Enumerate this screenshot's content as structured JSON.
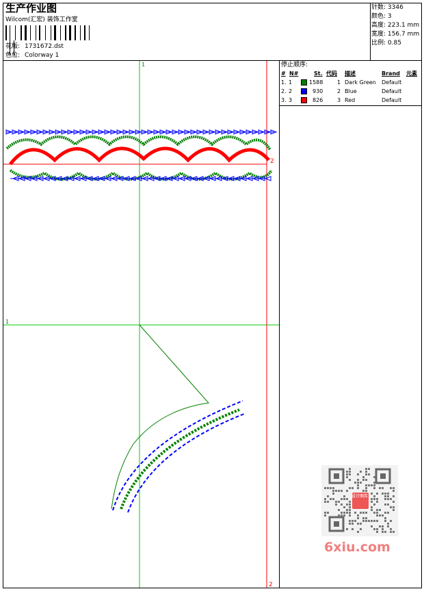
{
  "header": {
    "title": "生产作业图",
    "company": "Wilcom(汇宏) 装饰工作室",
    "design_label": "花版:",
    "design_value": "1731672.dst",
    "colorway_label": "色位:",
    "colorway_value": "Colorway 1"
  },
  "stats": [
    {
      "label": "针数:",
      "value": "3346"
    },
    {
      "label": "颜色:",
      "value": "3"
    },
    {
      "label": "高度:",
      "value": "223.1 mm"
    },
    {
      "label": "宽度:",
      "value": "156.7 mm"
    },
    {
      "label": "比例:",
      "value": "0.85"
    }
  ],
  "sequence": {
    "title": "停止顺序:",
    "columns": [
      "#",
      "N#",
      "St.",
      "代码",
      "描述",
      "Brand",
      "元素"
    ],
    "rows": [
      {
        "idx": "1.",
        "n": "1",
        "stitches": "1588",
        "code": "1",
        "description": "Dark Green",
        "brand": "Default",
        "color": "#008000"
      },
      {
        "idx": "2.",
        "n": "2",
        "stitches": "930",
        "code": "2",
        "description": "Blue",
        "brand": "Default",
        "color": "#0000ff"
      },
      {
        "idx": "3.",
        "n": "3",
        "stitches": "826",
        "code": "3",
        "description": "Red",
        "brand": "Default",
        "color": "#ff0000"
      }
    ]
  },
  "canvas": {
    "axis_labels": {
      "top_green": "1",
      "left_green": "1",
      "right_red_upper": "2",
      "bottom_red": "2"
    }
  },
  "watermark": {
    "text": "6xiu.com",
    "badge": "设计图库"
  },
  "colors": {
    "green": "#00cc00",
    "red": "#ff0000",
    "blue": "#0000ff",
    "dark_green": "#008000"
  }
}
